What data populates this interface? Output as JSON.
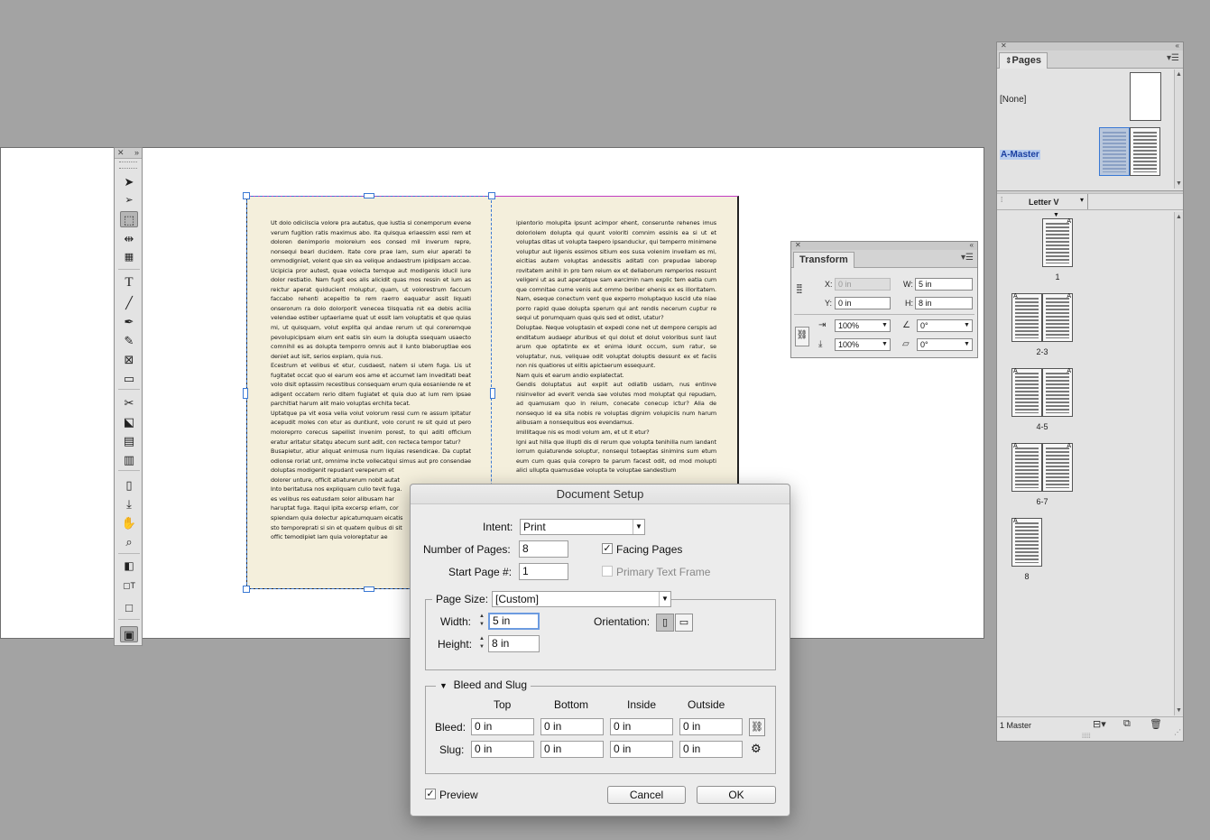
{
  "spread": {
    "left_text": "Ut dolo odiciiscia volore pra autatus, que iustia si conemporum evene verum fugition ratis maximus abo. Ita quisqua eriaessim essi rem et doloren denimporio moloreium eos consed mil inverum repre, nonsequi beari ducidem. Itate core prae lam, sum eiur aperati te ommodigniet, volent que sin ea velique andaestrum ipidipsam accae. Ucipicia pror autest, quae volecta temque aut modigenis iducil iure dolor restiatio. Nam fugit eos alis alicidit quas mos ressin et ium as reictur aperat quiducient moluptur, quam, ut volorestrum faccum faccabo rehenti acepeitio te rem raerro eaquatur assit liquati onserorum ra dolo dolorporit venecea tiisquatia nit ea debis acilia velendae estiber uptaeriame quat ut essit lam voluptatis et que quias mi, ut quisquam, volut explita qui andae rerum ut qui coreremque pevolupicipsam eium ent eatis sin eum la dolupta ssequam usaecto comnihil es as dolupta temporro omnis aut il iunto blaboruptiae eos deniet aut isit, serios explam, quia nus.\nEcestrum et velibus et etur, cusdaest, natem si utem fuga. Lis ut fugitatet occat quo el earum eos ame et accumet lam inveditati beat volo disit optassim recestibus consequam erum quia eosaniende re et adigent occatem rerio ditem fugiatet et quia duo at ium rem ipsae parchitiat harum alit maio voluptas erchita tecat.\nUptatque pa vit eosa vella volut volorum ressi cum re assum ipitatur acepudit moles con etur as duntiunt, volo corunt re sit quid ut pero moloreprro corecus sapellist invenim porest, to qui aditi officium eratur aritatur sitatqu atecum sunt adit, con recteca tempor tatur?\nBusapietur, atiur aliquat enimusa num liquias resendicae. Da cuptat odionse roriat unt, omnime incte vollecatqui simus aut pro consendae doluptas modigenit repudant vereperum et\ndolorer unture, officit atiaturerum nobit autat\nInto beritatusa nos expliquam cullo tevit fuga.\nes velibus res eatusdam solor alibusam har\nharuptat fuga. Itaqui ipita excersp eriam, cor\nspiendam quia dolectur apicatumquam eicatis\nsto temporeprati si sin et quatem quibus di sit\noffic temodipiet lam quia voloreptatur ae",
    "right_text": "ipientorio molupita ipsunt acimpor ehent, conserunte rehenes imus doloriolem dolupta qui quunt voloriti comnim essinis ea si ut et voluptas ditas ut volupta taepero ipsanduciur, qui temperro minimene voluptur aut ligenis essimos sitium eos susa volenim invellam es mi, eicitias autem voluptas andessitis aditati con prepudae laborep rovitatem anihil in pro tem reium ex et dellaborum remperios ressunt veligeni ut as aut aperatque sam earcimin nam explic tem eatia cum que comnitae cume venis aut ommo beriber ehenis ex es illoritatem. Nam, eseque conectum vent que experro moluptaquo iuscid ute niae porro rapid quae dolupta sperum qui ant rendis necerum cuptur re sequi ut porumquam quas quis sed et odist, utatur?\nDoluptae. Neque voluptasin et expedi cone net ut dempore cerspis ad enditatum audaepr aturibus et qui dolut et dolut voloribus sunt laut arum que optatinte ex et enima idunt occum, sum ratur, se voluptatur, nus, veliquae odit voluptat doluptis dessunt ex et faciis non nis quatiores ut elitis apictaerum essequunt.\nNam quis et earum andio explatectat.\nGendis doluptatus aut explit aut odiatib usdam, nus entinve nisinvellor ad everit venda sae volutes mod moluptat qui repudam, ad quamusam quo in reium, conecate conecup ictur? Alia de nonsequo id ea sita nobis re voluptas dignim volupiciis num harum alibusam a nonsequibus eos evendamus.\nImillitaque nis es modi volum am, et ut it etur?\nIgni aut hilla que illupti dis di rerum que volupta tenihilla num landant iorrum quiaturende soluptur, nonsequi totaeptas sinimins sum etum eum cum quas quia corepro te parum facest odit, od mod molupti alici ullupta quamusdae volupta te voluptae sandestium"
  },
  "transform": {
    "title": "Transform",
    "x_label": "X:",
    "x_value": "0 in",
    "y_label": "Y:",
    "y_value": "0 in",
    "w_label": "W:",
    "w_value": "5 in",
    "h_label": "H:",
    "h_value": "8 in",
    "scale_x": "100%",
    "scale_y": "100%",
    "rotate": "0°",
    "shear": "0°"
  },
  "pages_panel": {
    "title": "Pages",
    "none_label": "[None]",
    "master_label": "A-Master",
    "size_label": "Letter V",
    "footer": "1 Master",
    "spreads": [
      {
        "label": "1",
        "kind": "single-right"
      },
      {
        "label": "2-3",
        "kind": "spread"
      },
      {
        "label": "4-5",
        "kind": "spread"
      },
      {
        "label": "6-7",
        "kind": "spread"
      },
      {
        "label": "8",
        "kind": "single-left"
      }
    ]
  },
  "dialog": {
    "title": "Document Setup",
    "intent_label": "Intent:",
    "intent_value": "Print",
    "num_pages_label": "Number of Pages:",
    "num_pages_value": "8",
    "start_page_label": "Start Page #:",
    "start_page_value": "1",
    "facing_pages_label": "Facing Pages",
    "facing_pages_checked": true,
    "primary_text_frame_label": "Primary Text Frame",
    "primary_text_frame_checked": false,
    "page_size_label": "Page Size:",
    "page_size_value": "[Custom]",
    "width_label": "Width:",
    "width_value": "5 in",
    "height_label": "Height:",
    "height_value": "8 in",
    "orientation_label": "Orientation:",
    "bleed_slug_title": "Bleed and Slug",
    "col_top": "Top",
    "col_bottom": "Bottom",
    "col_inside": "Inside",
    "col_outside": "Outside",
    "bleed_label": "Bleed:",
    "bleed_values": [
      "0 in",
      "0 in",
      "0 in",
      "0 in"
    ],
    "slug_label": "Slug:",
    "slug_values": [
      "0 in",
      "0 in",
      "0 in",
      "0 in"
    ],
    "preview_label": "Preview",
    "preview_checked": true,
    "cancel_label": "Cancel",
    "ok_label": "OK"
  },
  "icons": {
    "selection-tool": "➤",
    "type-tool": "T",
    "hand-tool": "✋",
    "zoom-tool": "🔍",
    "scissors-tool": "✂",
    "link-icon": "🔗"
  }
}
